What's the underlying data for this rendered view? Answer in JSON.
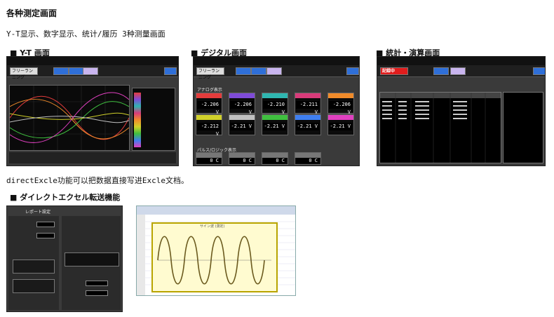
{
  "page": {
    "title": "各种测定画面",
    "subtitle": "Y-T显示、数字显示、统计/履历 3种测量画面",
    "note": "directExcle功能可以把数据直接写进Excle文档。"
  },
  "sections": {
    "yt_label": "■ Y-T 画面",
    "digital_label": "■ デジタル画面",
    "stats_label": "■ 統計・演算画面",
    "excel_label": "■ ダイレクトエクセル転送機能"
  },
  "yt_screen": {
    "mode_label": "フリーランニング"
  },
  "digital_screen": {
    "mode_label": "フリーランニング",
    "analog_header": "アナログ表示",
    "pulse_header": "パルス/ロジック表示",
    "readings": [
      "-2.206 V",
      "-2.206 V",
      "-2.210 V",
      "-2.211 V",
      "-2.206 V",
      "-2.212 V",
      "-2.21 V",
      "-2.21 V",
      "-2.21 V",
      "-2.21 V"
    ],
    "pulse_values": [
      "0 C",
      "0 C",
      "0 C",
      "0 C"
    ],
    "colors": [
      "#e33c3c",
      "#7f4bd8",
      "#2fb6b0",
      "#d93b7a",
      "#f08b2a",
      "#d0d02a",
      "#c0c0c0",
      "#3fbf3f",
      "#3f7ff0",
      "#e040c0"
    ]
  },
  "stats_screen": {
    "status_label": "記録中",
    "rows": 15
  },
  "excel_transfer": {
    "dialog_title": "レポート設定",
    "chart_title": "サイン波 (測定)"
  }
}
